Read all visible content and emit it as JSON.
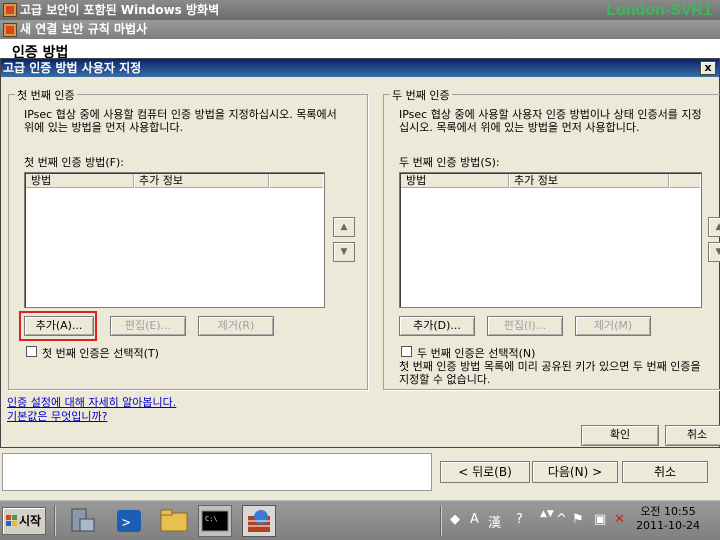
{
  "window1": {
    "title": "고급 보안이 포함된 Windows 방화벽",
    "brand": "London-SVR1"
  },
  "wizard": {
    "title": "새 연결 보안 규칙 마법사",
    "heading": "인증 방법",
    "back_label": "< 뒤로(B)",
    "next_label": "다음(N) >",
    "cancel_label": "취소"
  },
  "dialog": {
    "title": "고급 인증 방법 사용자 지정",
    "close_glyph": "x",
    "first": {
      "group_label": "첫 번째 인증",
      "desc_line1": "IPsec 협상 중에 사용할 컴퓨터 인증 방법을 지정하십시오. 목록에서",
      "desc_line2": "위에 있는 방법을 먼저 사용합니다.",
      "methods_label": "첫 번째 인증 방법(F):",
      "columns": [
        "방법",
        "추가 정보"
      ],
      "add_label": "추가(A)...",
      "edit_label": "편집(E)...",
      "remove_label": "제거(R)",
      "optional_label": "첫 번째 인증은 선택적(T)"
    },
    "second": {
      "group_label": "두 번째 인증",
      "desc_line1": "IPsec 협상 중에 사용할 사용자 인증 방법이나 상태 인증서를 지정",
      "desc_line2": "십시오. 목록에서 위에 있는 방법을 먼저 사용합니다.",
      "methods_label": "두 번째 인증 방법(S):",
      "columns": [
        "방법",
        "추가 정보"
      ],
      "add_label": "추가(D)...",
      "edit_label": "편집(I)...",
      "remove_label": "제거(M)",
      "optional_label": "두 번째 인증은 선택적(N)",
      "note_line1": "첫 번째 인증 방법 목록에 미리 공유된 키가 있으면 두 번째 인증을",
      "note_line2": "지정할 수 없습니다."
    },
    "link_learn": "인증 설정에 대해 자세히 알아봅니다.",
    "link_defaults": "기본값은 무엇입니까?",
    "ok_label": "확인",
    "cancel_label": "취소"
  },
  "taskbar": {
    "start_label": "시작",
    "ime_a": "A",
    "ime_han": "漢",
    "clock_time": "오전 10:55",
    "clock_date": "2011-10-24"
  }
}
